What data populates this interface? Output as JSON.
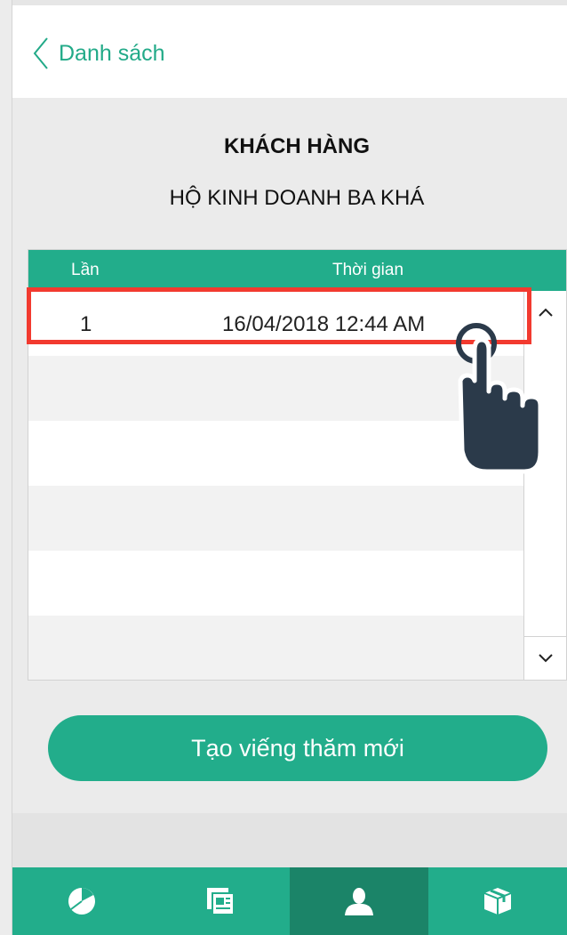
{
  "header": {
    "back_label": "Danh sách"
  },
  "customer": {
    "title": "KHÁCH HÀNG",
    "name": "HỘ KINH DOANH BA KHÁ"
  },
  "table": {
    "columns": [
      "Lần",
      "Thời gian"
    ],
    "rows": [
      {
        "lan": "1",
        "time": "16/04/2018 12:44 AM"
      }
    ]
  },
  "actions": {
    "new_visit": "Tạo viếng thăm mới"
  },
  "tabbar": {
    "active_index": 2,
    "tabs": [
      {
        "icon": "pie-chart-icon"
      },
      {
        "icon": "documents-icon"
      },
      {
        "icon": "user-icon"
      },
      {
        "icon": "box-icon"
      }
    ]
  },
  "colors": {
    "accent": "#22ad8b",
    "accent_dark": "#1b8468",
    "highlight": "#f23a2f",
    "hand": "#2b3a4a"
  }
}
